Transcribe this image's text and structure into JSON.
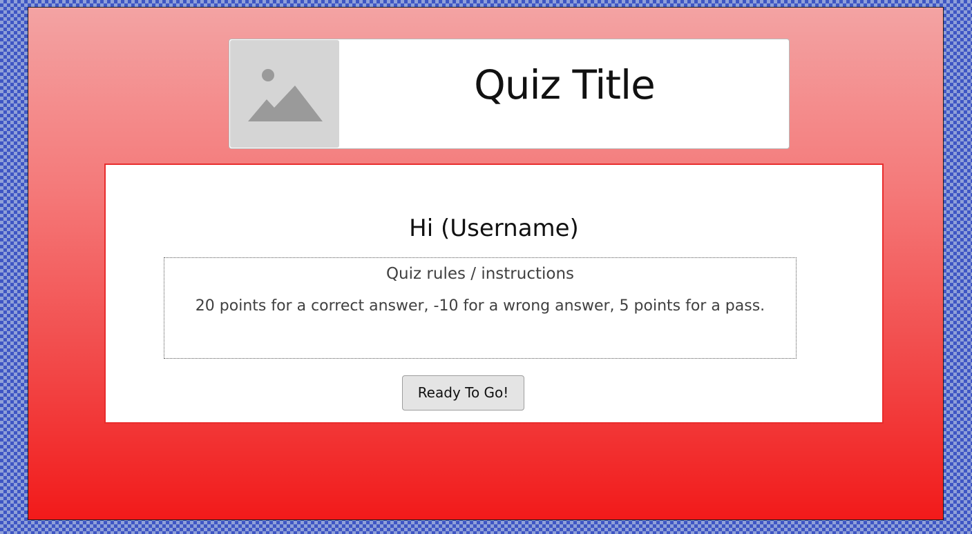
{
  "header": {
    "title": "Quiz Title",
    "thumbnail_icon": "image-placeholder-icon"
  },
  "welcome": {
    "greeting": "Hi (Username)",
    "rules_heading": "Quiz rules / instructions",
    "rules_text": "20 points for a correct answer, -10 for a wrong answer, 5 points for a pass.",
    "start_button_label": "Ready To Go!"
  },
  "colors": {
    "background_gradient_top": "#f3a3a3",
    "background_gradient_bottom": "#f21a1a",
    "card_border": "#e82c2c",
    "checkerboard": "#3f56c4"
  }
}
